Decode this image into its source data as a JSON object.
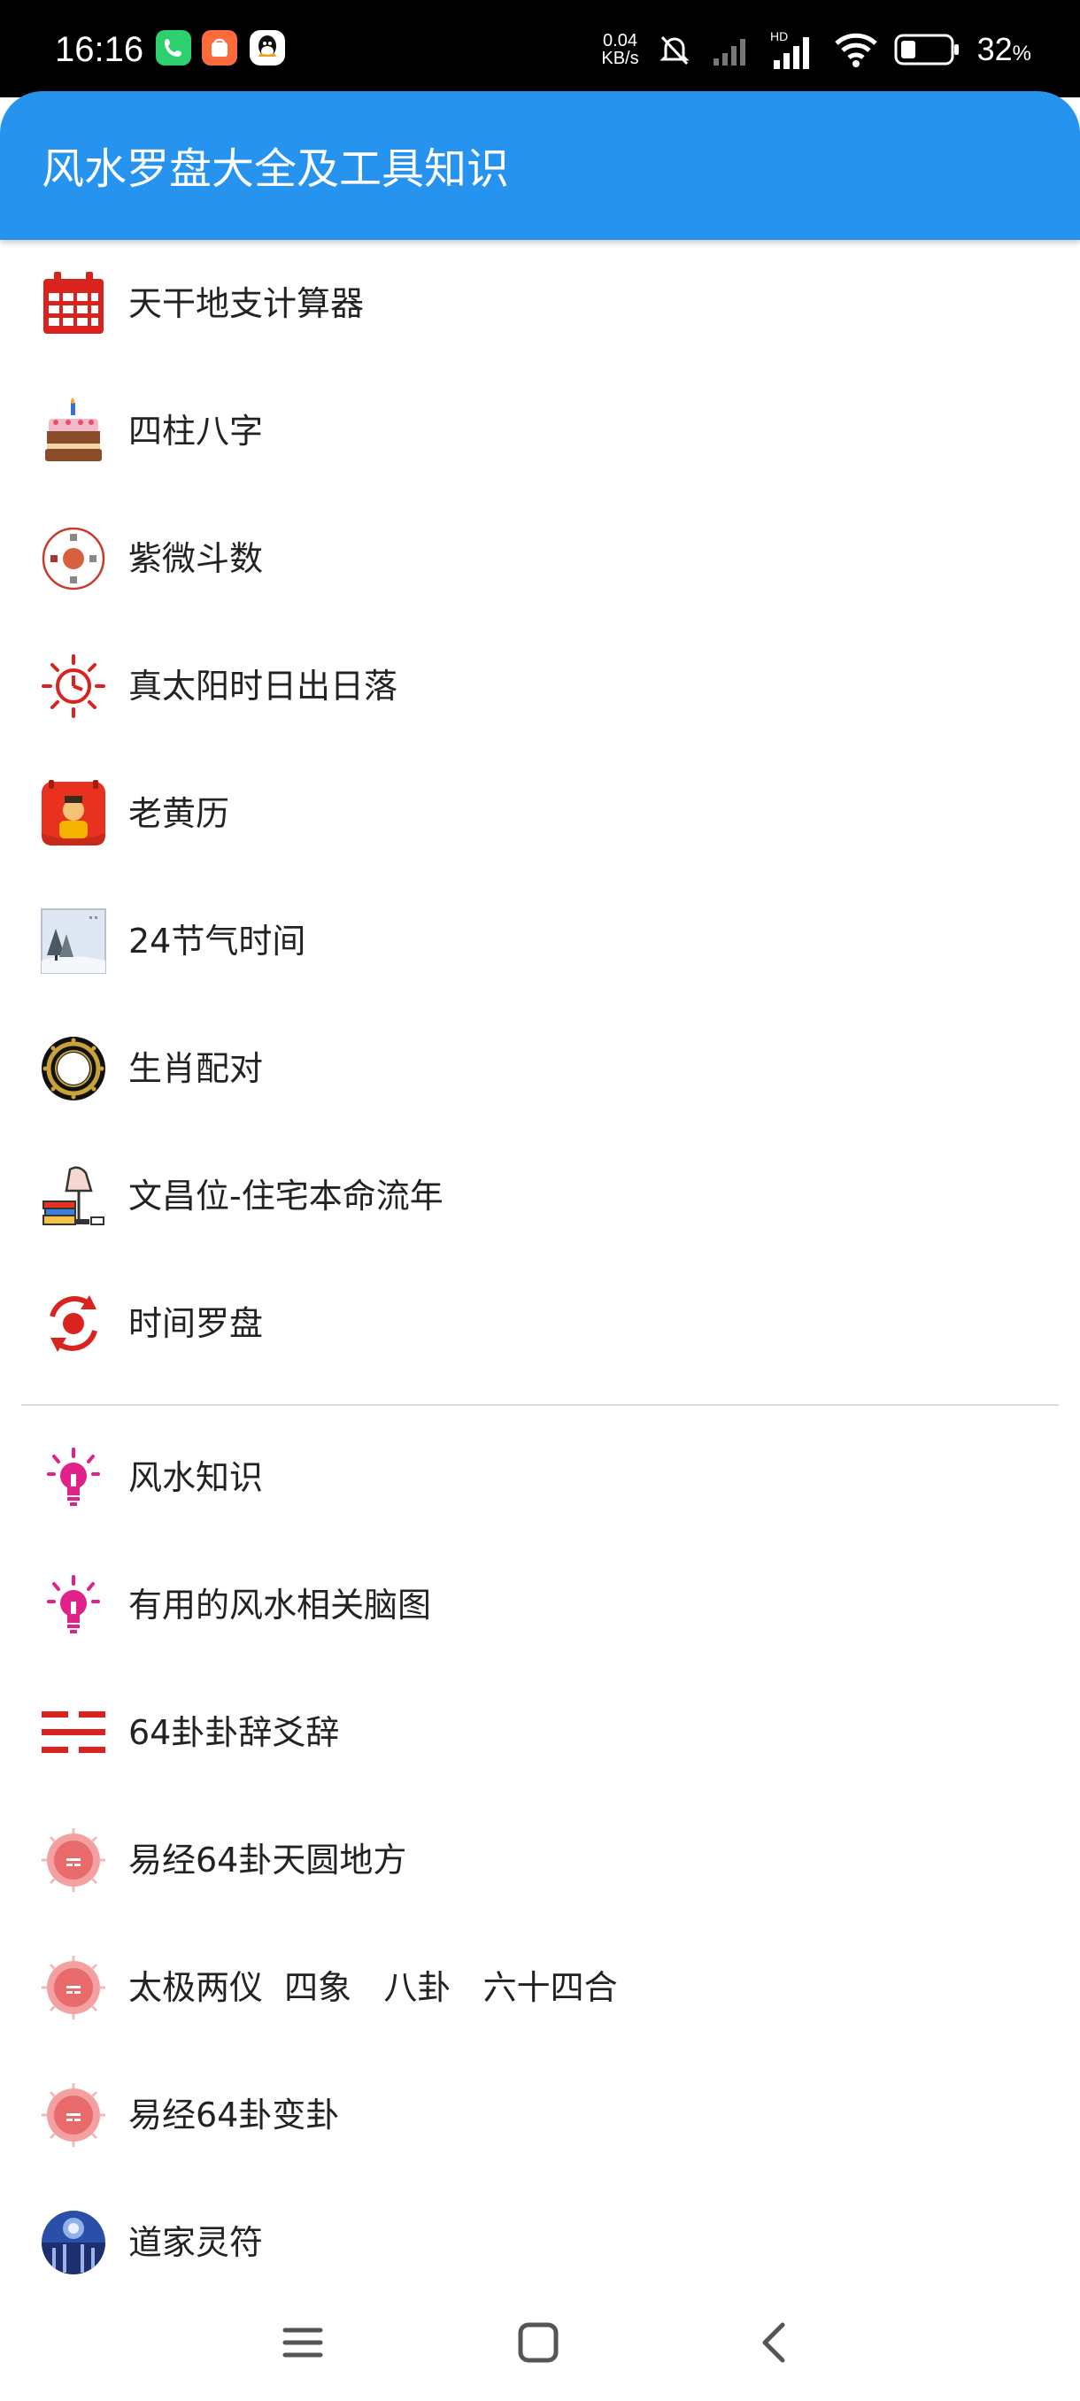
{
  "status_bar": {
    "time": "16:16",
    "net_speed_value": "0.04",
    "net_speed_unit": "KB/s",
    "network_type": "HD",
    "battery": "32",
    "battery_unit": "%"
  },
  "app_bar": {
    "title": "风水罗盘大全及工具知识"
  },
  "tools_section": {
    "items": [
      {
        "label": "天干地支计算器",
        "icon": "calendar-icon"
      },
      {
        "label": "四柱八字",
        "icon": "cake-icon"
      },
      {
        "label": "紫微斗数",
        "icon": "ziwei-chart-icon"
      },
      {
        "label": "真太阳时日出日落",
        "icon": "sun-clock-icon"
      },
      {
        "label": "老黄历",
        "icon": "almanac-icon"
      },
      {
        "label": "24节气时间",
        "icon": "snow-landscape-icon"
      },
      {
        "label": "生肖配对",
        "icon": "zodiac-wheel-icon"
      },
      {
        "label": "文昌位-住宅本命流年",
        "icon": "desk-lamp-books-icon"
      },
      {
        "label": "时间罗盘",
        "icon": "refresh-compass-icon"
      }
    ]
  },
  "knowledge_section": {
    "items": [
      {
        "label": "风水知识",
        "icon": "lightbulb-icon"
      },
      {
        "label": "有用的风水相关脑图",
        "icon": "lightbulb-icon"
      },
      {
        "label": "64卦卦辞爻辞",
        "icon": "hexagram-lines-icon"
      },
      {
        "label": "易经64卦天圆地方",
        "icon": "bagua-circle-icon"
      },
      {
        "label": "太极两仪  四象   八卦   六十四合",
        "icon": "bagua-circle-icon"
      },
      {
        "label": "易经64卦变卦",
        "icon": "bagua-circle-icon"
      },
      {
        "label": "道家灵符",
        "icon": "taoist-talisman-icon"
      }
    ]
  },
  "colors": {
    "app_bar": "#2693ef",
    "icon_red": "#d9231f",
    "icon_pink": "#e0218a"
  }
}
